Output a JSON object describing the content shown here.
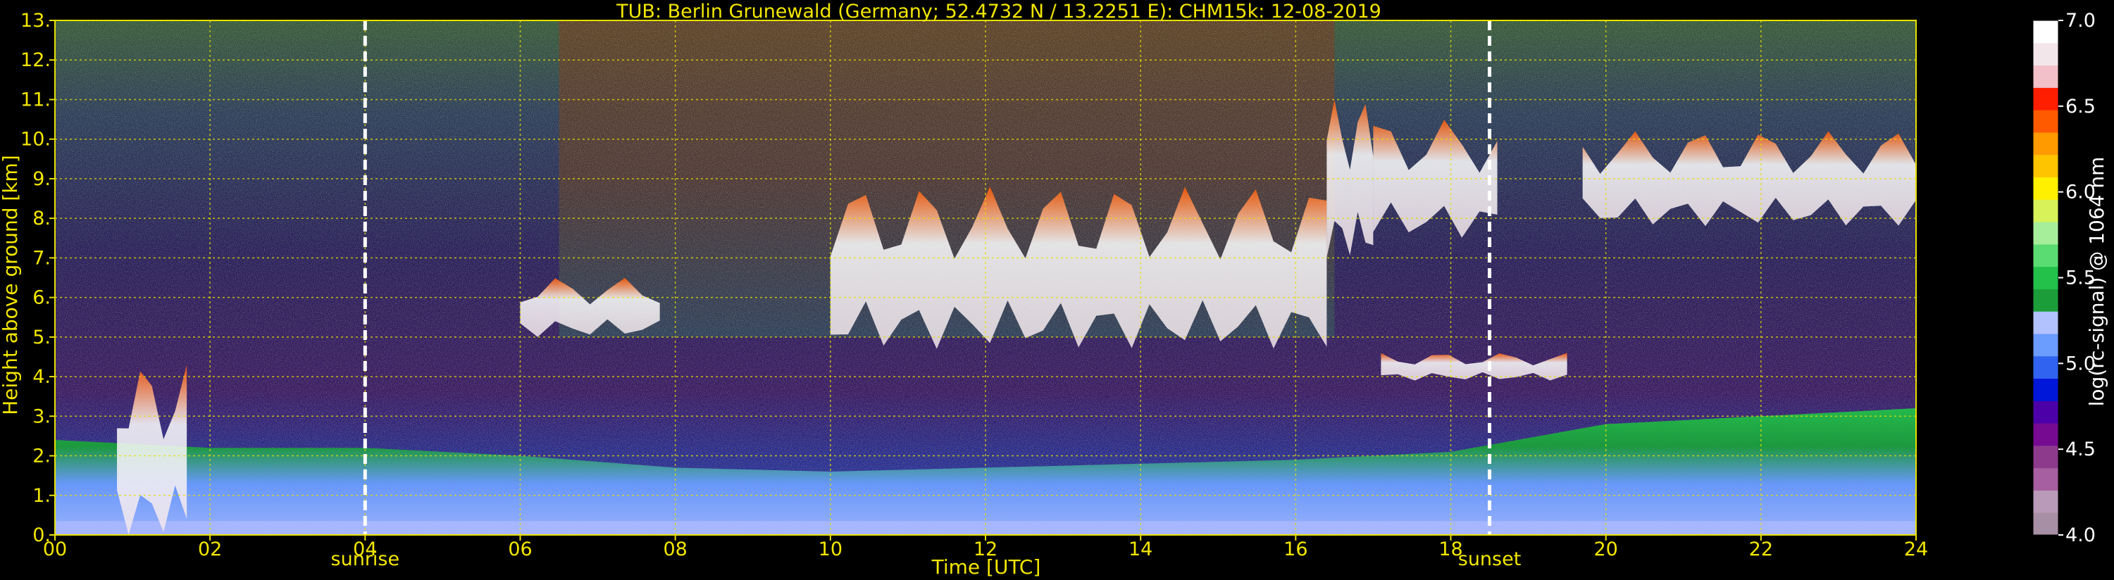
{
  "chart_data": {
    "type": "heatmap",
    "title": "TUB: Berlin Grunewald (Germany; 52.4732 N / 13.2251 E):    CHM15k: 12-08-2019",
    "xlabel": "Time [UTC]",
    "ylabel": "Height above ground [km]",
    "xlim": [
      0,
      24
    ],
    "ylim": [
      0,
      13
    ],
    "x_ticks": [
      "00",
      "02",
      "04",
      "06",
      "08",
      "10",
      "12",
      "14",
      "16",
      "18",
      "20",
      "22",
      "24"
    ],
    "y_ticks": [
      "0.",
      "1.",
      "2.",
      "3.",
      "4.",
      "5.",
      "6.",
      "7.",
      "8.",
      "9.",
      "10.",
      "11.",
      "12.",
      "13."
    ],
    "grid": true,
    "markers": [
      {
        "label": "sunrise",
        "x": 4.0
      },
      {
        "label": "sunset",
        "x": 18.5
      }
    ],
    "colorbar": {
      "label": "log(rc-signal) @ 1064 nm",
      "range": [
        4.0,
        7.0
      ],
      "ticks": [
        "4.0",
        "4.5",
        "5.0",
        "5.5",
        "6.0",
        "6.5",
        "7.0"
      ],
      "colors": [
        "#a78fa5",
        "#b99ab8",
        "#a65fa0",
        "#8d3a8d",
        "#760b92",
        "#4b00a8",
        "#0016d9",
        "#2f63f0",
        "#6b9cff",
        "#b2c2ff",
        "#1b9e3a",
        "#23c04a",
        "#5bdc72",
        "#a7ee9b",
        "#d8f25a",
        "#fff000",
        "#ffc400",
        "#ff9a00",
        "#ff5a00",
        "#ff1e00",
        "#f2c0c8",
        "#f3e6ea",
        "#ffffff"
      ]
    },
    "features": [
      {
        "kind": "boundary_layer",
        "x_start": 0,
        "x_end": 24,
        "top_km": [
          2.4,
          2.2,
          2.2,
          2.0,
          1.7,
          1.6,
          1.7,
          1.8,
          1.9,
          2.1,
          2.8,
          3.0,
          3.2
        ]
      },
      {
        "kind": "cloud",
        "x_start": 6.0,
        "x_end": 7.8,
        "base_km": 5.0,
        "top_km": 6.5
      },
      {
        "kind": "cloud",
        "x_start": 10.0,
        "x_end": 16.4,
        "base_km": 4.7,
        "top_km": 8.8
      },
      {
        "kind": "cloud",
        "x_start": 16.4,
        "x_end": 17.0,
        "base_km": 7.0,
        "top_km": 11.0
      },
      {
        "kind": "cloud",
        "x_start": 17.0,
        "x_end": 18.6,
        "base_km": 7.5,
        "top_km": 10.5
      },
      {
        "kind": "cloud",
        "x_start": 17.1,
        "x_end": 19.5,
        "base_km": 3.9,
        "top_km": 4.6
      },
      {
        "kind": "cloud",
        "x_start": 19.7,
        "x_end": 24.0,
        "base_km": 7.8,
        "top_km": 10.2
      },
      {
        "kind": "cloud",
        "x_start": 0.8,
        "x_end": 1.7,
        "base_km": 0.0,
        "top_km": 4.3
      }
    ]
  }
}
